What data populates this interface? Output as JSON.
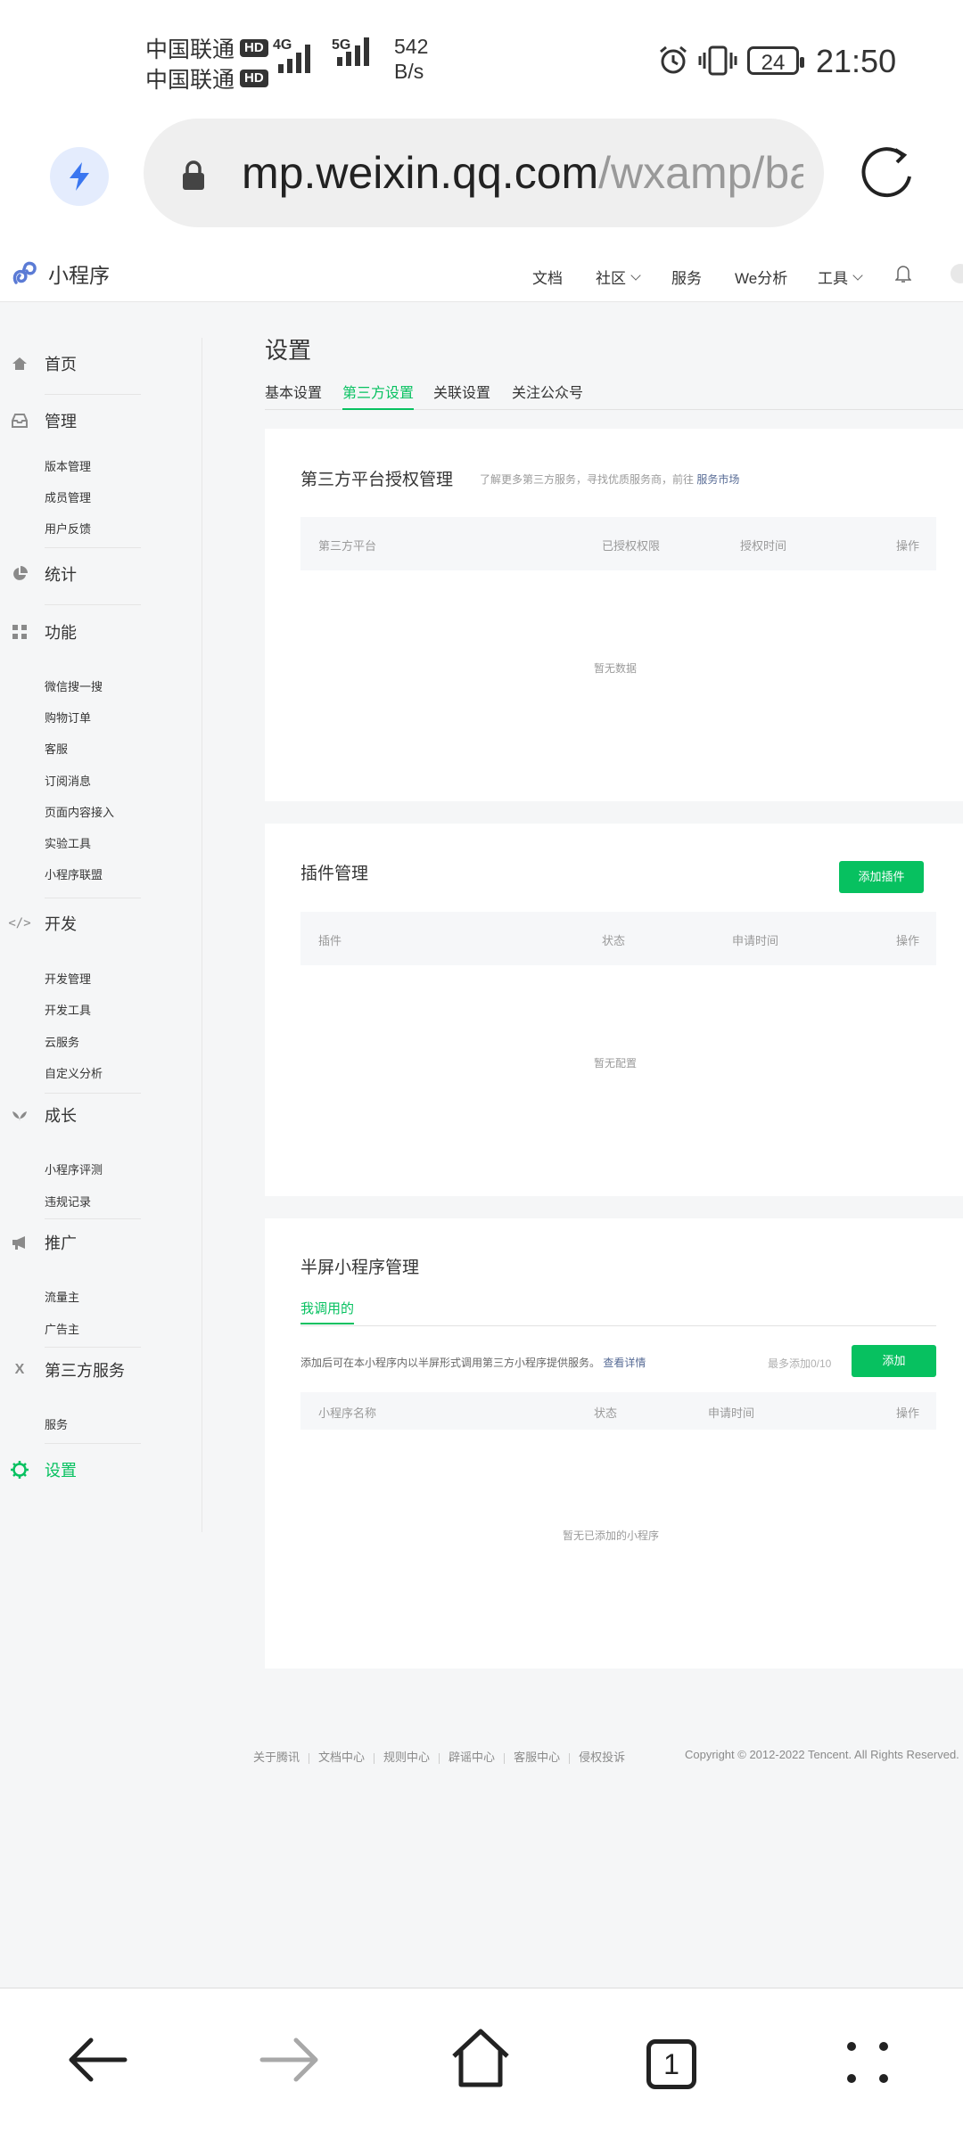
{
  "status_bar": {
    "carrier1": "中国联通",
    "carrier2": "中国联通",
    "hd_badge": "HD",
    "net1": "4G",
    "net2": "5G",
    "speed_value": "542",
    "speed_unit": "B/s",
    "battery": "24",
    "time": "21:50"
  },
  "browser": {
    "url_host": "mp.weixin.qq.com",
    "url_path": "/wxamp/ba"
  },
  "header": {
    "logo_text": "小程序",
    "nav": [
      "文档",
      "社区",
      "服务",
      "We分析",
      "工具"
    ]
  },
  "sidebar": {
    "home": "首页",
    "manage": {
      "label": "管理",
      "items": [
        "版本管理",
        "成员管理",
        "用户反馈"
      ]
    },
    "stats": "统计",
    "features": {
      "label": "功能",
      "items": [
        "微信搜一搜",
        "购物订单",
        "客服",
        "订阅消息",
        "页面内容接入",
        "实验工具",
        "小程序联盟"
      ]
    },
    "dev": {
      "label": "开发",
      "items": [
        "开发管理",
        "开发工具",
        "云服务",
        "自定义分析"
      ]
    },
    "growth": {
      "label": "成长",
      "items": [
        "小程序评测",
        "违规记录"
      ]
    },
    "promo": {
      "label": "推广",
      "items": [
        "流量主",
        "广告主"
      ]
    },
    "third": {
      "label": "第三方服务",
      "items": [
        "服务"
      ]
    },
    "settings": "设置"
  },
  "main": {
    "title": "设置",
    "tabs": [
      "基本设置",
      "第三方设置",
      "关联设置",
      "关注公众号"
    ],
    "third_party": {
      "title": "第三方平台授权管理",
      "desc": "了解更多第三方服务，寻找优质服务商，前往",
      "link": "服务市场",
      "columns": [
        "第三方平台",
        "已授权权限",
        "授权时间",
        "操作"
      ],
      "empty": "暂无数据"
    },
    "plugins": {
      "title": "插件管理",
      "add_button": "添加插件",
      "columns": [
        "插件",
        "状态",
        "申请时间",
        "操作"
      ],
      "empty": "暂无配置"
    },
    "half_screen": {
      "title": "半屏小程序管理",
      "subtab": "我调用的",
      "desc": "添加后可在本小程序内以半屏形式调用第三方小程序提供服务。",
      "link": "查看详情",
      "limit": "最多添加0/10",
      "add_button": "添加",
      "columns": [
        "小程序名称",
        "状态",
        "申请时间",
        "操作"
      ],
      "empty": "暂无已添加的小程序"
    }
  },
  "footer": {
    "links": [
      "关于腾讯",
      "文档中心",
      "规则中心",
      "辟谣中心",
      "客服中心",
      "侵权投诉"
    ],
    "copyright": "Copyright © 2012-2022 Tencent. All Rights Reserved."
  },
  "bottom_nav": {
    "tab_count": "1"
  },
  "colors": {
    "accent": "#07c160",
    "link": "#576b95"
  }
}
